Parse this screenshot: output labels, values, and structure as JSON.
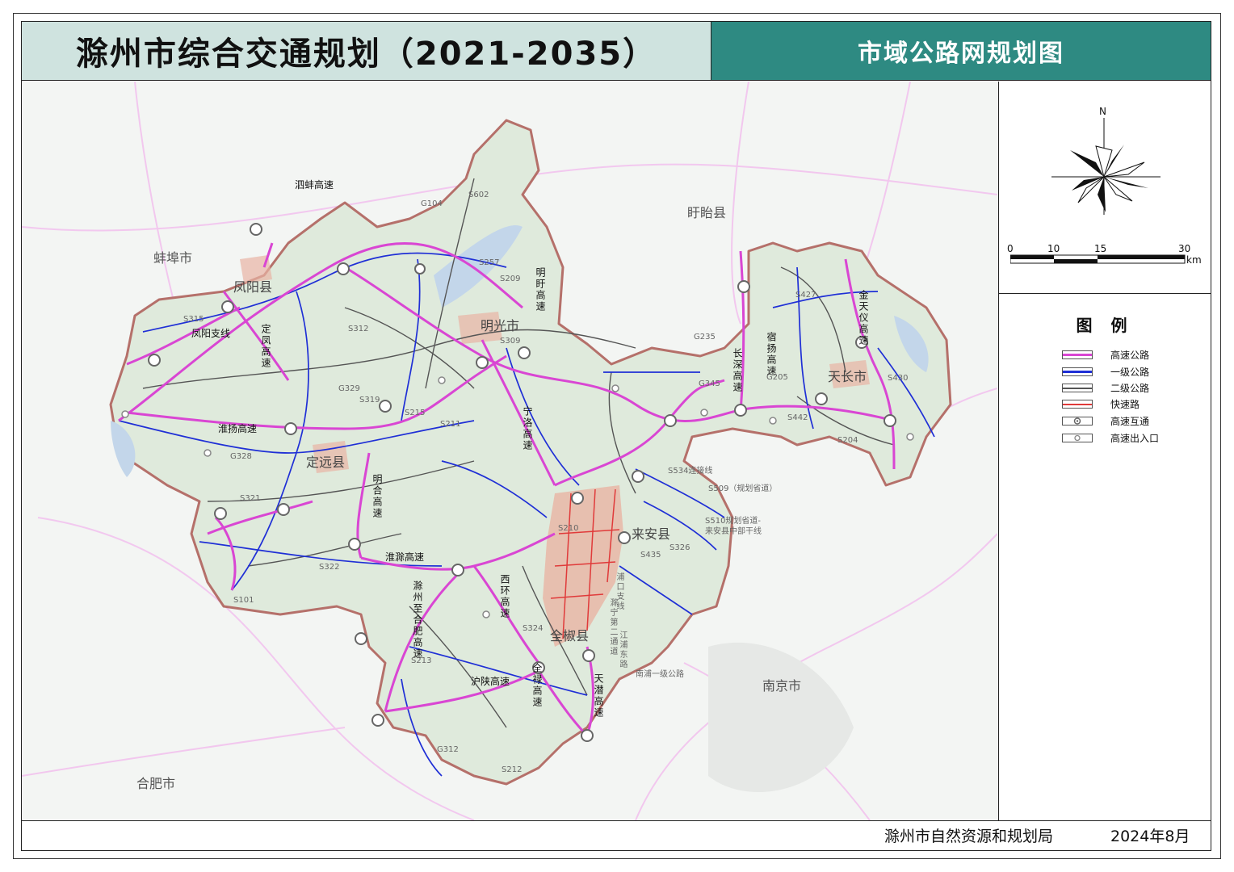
{
  "header": {
    "title": "滁州市综合交通规划（2021-2035）",
    "subtitle": "市域公路网规划图"
  },
  "footer": {
    "org": "滁州市自然资源和规划局",
    "date": "2024年8月"
  },
  "compass": {
    "north_label": "N"
  },
  "scale_bar": {
    "ticks": [
      "0",
      "10",
      "15",
      "30"
    ],
    "unit": "km"
  },
  "legend": {
    "title": "图 例",
    "items": [
      {
        "label": "高速公路",
        "color": "#d946d3"
      },
      {
        "label": "一级公路",
        "color": "#1f2fd6"
      },
      {
        "label": "二级公路",
        "color": "#555555"
      },
      {
        "label": "快速路",
        "color": "#e03a3a"
      },
      {
        "label": "高速互通",
        "color": "#666666"
      },
      {
        "label": "高速出入口",
        "color": "#888888"
      }
    ]
  },
  "map": {
    "colors": {
      "region_fill": "#dfeadc",
      "boundary": "#b5706a",
      "highway": "#d946d3",
      "first_class": "#1f2fd6",
      "second_class": "#555555",
      "urban": "#e8b4a4"
    },
    "places": {
      "bengbu": "蚌埠市",
      "xuyi": "盱眙县",
      "hefei": "合肥市",
      "nanjing": "南京市",
      "fengyang": "凤阳县",
      "mingguang": "明光市",
      "dingyuan": "定远县",
      "laian": "来安县",
      "tianchang": "天长市",
      "quanjiao": "全椒县"
    },
    "routes": {
      "sibeng": "泗蚌高速",
      "fengyang_branch": "凤阳支线",
      "cufeng": "定凤高速",
      "mingxu": "明盱高速",
      "changshen": "长深高速",
      "jintianyi": "金天仪高速",
      "huaiyang": "淮扬高速",
      "minghe": "明合高速",
      "xulai": "宁洛高速",
      "huaichu": "淮滁高速",
      "chuquan": "滁州至合肥高速",
      "xihuan": "西环高速",
      "huangyang": "宿扬高速",
      "hushan": "沪陕高速",
      "quanlu": "全禄高速",
      "tianqian": "天潜高速",
      "s315": "S315",
      "g329": "G329",
      "s312": "S312",
      "s319": "S319",
      "s215": "S215",
      "g328": "G328",
      "s321": "S321",
      "s322": "S322",
      "s101": "S101",
      "g104": "G104",
      "s602": "S602",
      "s257": "S257",
      "s209": "S209",
      "s309": "S309",
      "s211": "S211",
      "g235": "G235",
      "g345": "G345",
      "s427": "S427",
      "s204": "S204",
      "g205": "G205",
      "s430": "S430",
      "s442": "S442",
      "s534": "S534连接线",
      "s509": "S509（规划省道）",
      "s510": "S510规划省道-",
      "s510b": "来安县中部干线",
      "s326": "S326",
      "s435": "S435",
      "g210": "S210",
      "s324": "S324",
      "s213": "S213",
      "s312b": "G312",
      "s212": "S212",
      "pukou": "浦口支线",
      "chuning": "滁宁第二通道",
      "jiangpu": "江浦东路",
      "nanqiao": "南浦一级公路"
    }
  }
}
